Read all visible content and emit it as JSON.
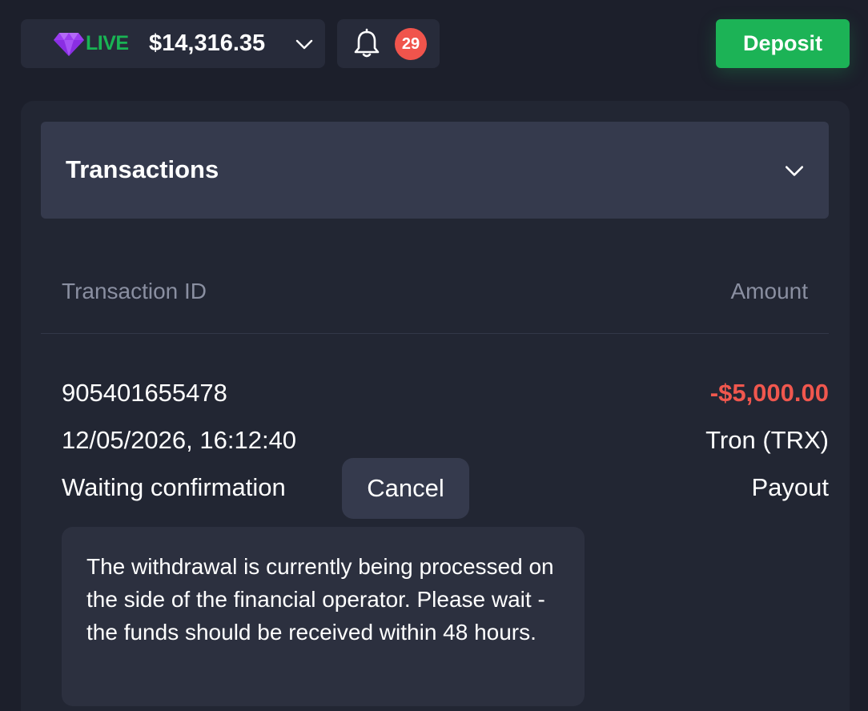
{
  "header": {
    "account_mode": "LIVE",
    "balance": "$14,316.35",
    "notifications_count": "29",
    "deposit_label": "Deposit"
  },
  "section": {
    "title": "Transactions"
  },
  "table": {
    "columns": [
      "Transaction ID",
      "Amount"
    ],
    "rows": [
      {
        "id": "905401655478",
        "datetime": "12/05/2026, 16:12:40",
        "status": "Waiting confirmation",
        "cancel_label": "Cancel",
        "amount": "-$5,000.00",
        "currency": "Tron (TRX)",
        "type": "Payout",
        "note": "The withdrawal is currently being processed on the side of the financial operator. Please wait - the funds should be received within 48 hours."
      }
    ]
  },
  "colors": {
    "live": "#19b454",
    "deposit": "#1cb356",
    "negative_amount": "#f0574e",
    "badge": "#f0544c",
    "background": "#1c1f2b"
  },
  "icons": [
    "diamond-icon",
    "chevron-down-icon",
    "bell-icon"
  ]
}
